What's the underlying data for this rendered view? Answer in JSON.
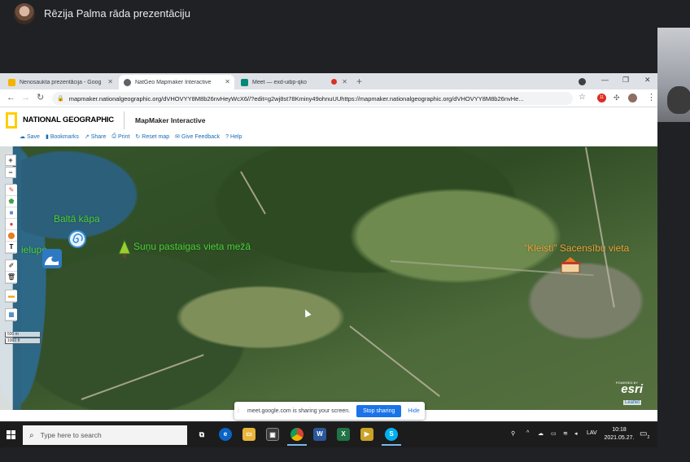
{
  "meet": {
    "presenter_label": "Rēzija Palma rāda prezentāciju"
  },
  "browser": {
    "tabs": [
      {
        "label": "Nenosaukta prezentācija - Goog",
        "favicon_color": "#f4b400"
      },
      {
        "label": "NatGeo Mapmaker Interactive",
        "favicon_color": "#5f6368"
      },
      {
        "label": "Meet — exd-uibp-qko",
        "favicon_color": "#00897b"
      }
    ],
    "new_tab": "+",
    "url": "mapmaker.nationalgeographic.org/dVHOVYY8M8b26nvHeyWcX6//?edit=g2wj8st78Kminy49ohnuUUhttps://mapmaker.nationalgeographic.org/dVHOVYY8M8b26nvHe...",
    "profile_badge": "11"
  },
  "natgeo": {
    "brand": "NATIONAL GEOGRAPHIC",
    "product": "MapMaker Interactive",
    "toolbar": [
      {
        "label": "Save",
        "icon": "cloud-icon"
      },
      {
        "label": "Bookmarks",
        "icon": "bookmark-icon"
      },
      {
        "label": "Share",
        "icon": "share-icon"
      },
      {
        "label": "Print",
        "icon": "print-icon"
      },
      {
        "label": "Reset map",
        "icon": "refresh-icon"
      },
      {
        "label": "Give Feedback",
        "icon": "mail-icon"
      },
      {
        "label": "Help",
        "icon": "help-icon"
      }
    ]
  },
  "map": {
    "zoom_in": "+",
    "zoom_out": "−",
    "labels": {
      "balta_kapa": "Baltā kāpa",
      "lielupe": "ielupe",
      "sunu": "Suņu pastaigas vieta mežā",
      "kleisti": "\"Kleisti\" Sacensību vieta"
    },
    "label_colors": {
      "green": "#4cd137",
      "orange": "#e8a33a"
    },
    "scale": [
      "500 m",
      "1000 ft"
    ],
    "esri": "esri",
    "esri_powered": "POWERED BY",
    "leaflet": "Leaflet"
  },
  "share_bar": {
    "text": "meet.google.com is sharing your screen.",
    "stop": "Stop sharing",
    "hide": "Hide"
  },
  "taskbar": {
    "search_placeholder": "Type here to search",
    "language": "LAV",
    "time": "10:18",
    "date": "2021.05.27.",
    "notification_count": "2"
  }
}
